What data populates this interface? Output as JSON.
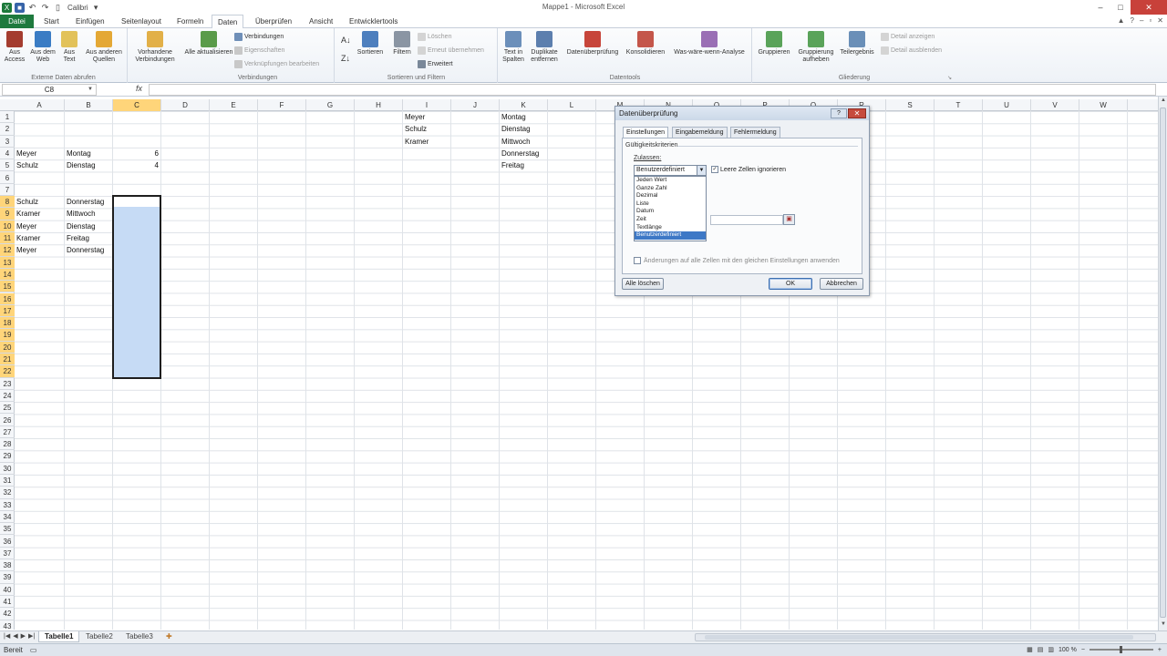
{
  "titlebar": {
    "quick_font": "Calibri",
    "title": "Mappe1 - Microsoft Excel",
    "controls": [
      "–",
      "□",
      "✕"
    ]
  },
  "ribbon_tabs": [
    {
      "label": "Datei"
    },
    {
      "label": "Start"
    },
    {
      "label": "Einfügen"
    },
    {
      "label": "Seitenlayout"
    },
    {
      "label": "Formeln"
    },
    {
      "label": "Daten"
    },
    {
      "label": "Überprüfen"
    },
    {
      "label": "Ansicht"
    },
    {
      "label": "Entwicklertools"
    }
  ],
  "ribbon": {
    "groups": {
      "external": "Externe Daten abrufen",
      "connections": "Verbindungen",
      "sortfilter": "Sortieren und Filtern",
      "datatools": "Datentools",
      "outline": "Gliederung"
    },
    "buttons": {
      "access": "Aus Access",
      "web": "Aus dem Web",
      "text": "Aus Text",
      "other": "Aus anderen Quellen",
      "existing": "Vorhandene Verbindungen",
      "refresh": "Alle aktualisieren",
      "conn": "Verbindungen",
      "props": "Eigenschaften",
      "editlinks": "Verknüpfungen bearbeiten",
      "sort": "Sortieren",
      "filter": "Filtern",
      "clear": "Löschen",
      "reapply": "Erneut übernehmen",
      "advanced": "Erweitert",
      "textcols": "Text in Spalten",
      "dupes": "Duplikate entfernen",
      "validation": "Datenüberprüfung",
      "consolidate": "Konsolidieren",
      "whatif": "Was-wäre-wenn-Analyse",
      "group": "Gruppieren",
      "ungroup": "Gruppierung aufheben",
      "subtotal": "Teilergebnis",
      "showdetail": "Detail anzeigen",
      "hidedetail": "Detail ausblenden"
    }
  },
  "formula_bar": {
    "namebox": "C8",
    "fx": "fx",
    "formula": ""
  },
  "columns": [
    "A",
    "B",
    "C",
    "D",
    "E",
    "F",
    "G",
    "H",
    "I",
    "J",
    "K",
    "L",
    "M",
    "N",
    "O",
    "P",
    "Q",
    "R",
    "S",
    "T",
    "U",
    "V",
    "W"
  ],
  "rows": [
    "1",
    "2",
    "3",
    "4",
    "5",
    "6",
    "7",
    "8",
    "9",
    "10",
    "11",
    "12",
    "13",
    "14",
    "15",
    "16",
    "17",
    "18",
    "19",
    "20",
    "21",
    "22",
    "23",
    "24",
    "25",
    "26",
    "27",
    "28",
    "29",
    "30",
    "31",
    "32",
    "33",
    "34",
    "35",
    "36",
    "37",
    "38",
    "39",
    "40",
    "41",
    "42",
    "43"
  ],
  "cells": {
    "I1": "Meyer",
    "I2": "Schulz",
    "I3": "Kramer",
    "K1": "Montag",
    "K2": "Dienstag",
    "K3": "Mittwoch",
    "K4": "Donnerstag",
    "K5": "Freitag",
    "A4": "Meyer",
    "B4": "Montag",
    "C4": "6",
    "A5": "Schulz",
    "B5": "Dienstag",
    "C5": "4",
    "A8": "Schulz",
    "B8": "Donnerstag",
    "A9": "Kramer",
    "B9": "Mittwoch",
    "A10": "Meyer",
    "B10": "Dienstag",
    "A11": "Kramer",
    "B11": "Freitag",
    "A12": "Meyer",
    "B12": "Donnerstag"
  },
  "sheets": [
    {
      "label": "Tabelle1",
      "active": true
    },
    {
      "label": "Tabelle2",
      "active": false
    },
    {
      "label": "Tabelle3",
      "active": false
    }
  ],
  "status": {
    "mode": "Bereit",
    "zoom": "100 %"
  },
  "dialog": {
    "title": "Datenüberprüfung",
    "help": "?",
    "close": "✕",
    "tabs": [
      "Einstellungen",
      "Eingabemeldung",
      "Fehlermeldung"
    ],
    "section": "Gültigkeitskriterien",
    "allow_label": "Zulassen:",
    "allow_value": "Benutzerdefiniert",
    "ignore_blank": "Leere Zellen ignorieren",
    "ignore_checked": "✓",
    "options": [
      "Jeden Wert",
      "Ganze Zahl",
      "Dezimal",
      "Liste",
      "Datum",
      "Zeit",
      "Textlänge",
      "Benutzerdefiniert"
    ],
    "apply_all": "Änderungen auf alle Zellen mit den gleichen Einstellungen anwenden",
    "clear_all": "Alle löschen",
    "ok": "OK",
    "cancel": "Abbrechen"
  }
}
